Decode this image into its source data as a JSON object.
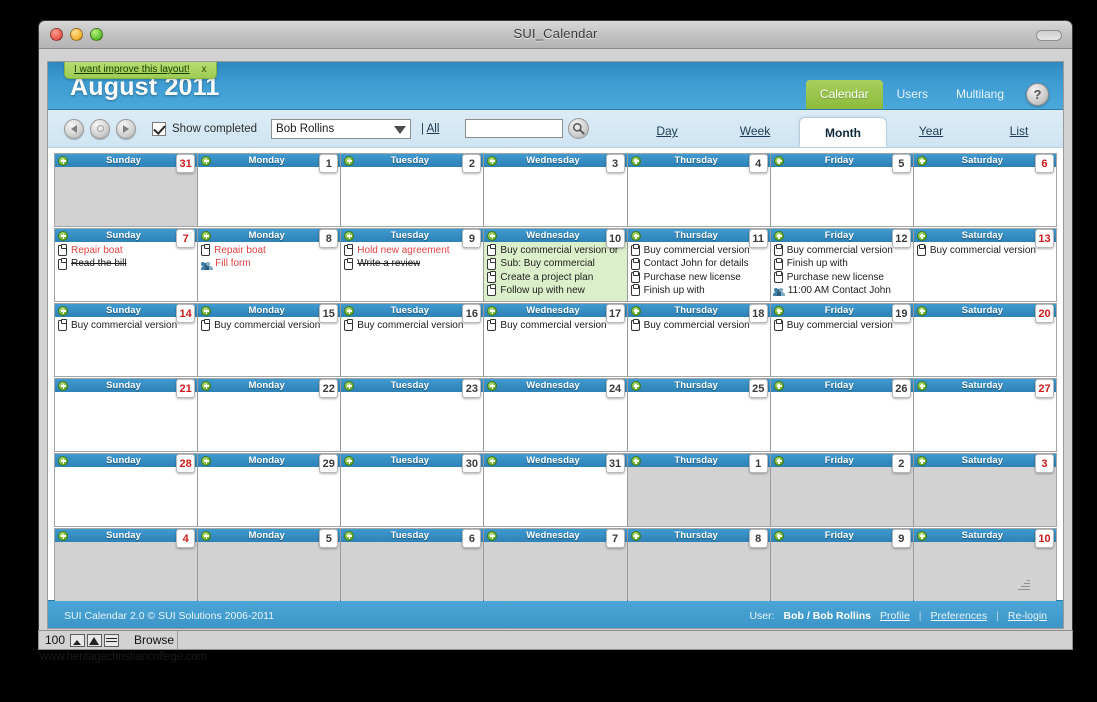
{
  "window": {
    "title": "SUI_Calendar",
    "traffic_lights": [
      "close",
      "minimize",
      "zoom"
    ]
  },
  "hint": {
    "text": "I want improve this layout!",
    "close": "x"
  },
  "header": {
    "month_title": "August 2011",
    "nav": [
      {
        "label": "Calendar",
        "active": true
      },
      {
        "label": "Users",
        "active": false
      },
      {
        "label": "Multilang",
        "active": false
      }
    ],
    "help_label": "?"
  },
  "toolbar": {
    "prev_label": "◀",
    "today_label": "●",
    "next_label": "▶",
    "show_completed_label": "Show completed",
    "show_completed_checked": true,
    "user_select_value": "Bob Rollins",
    "user_select_options": [
      "Bob Rollins"
    ],
    "all_separator": "|",
    "all_label": "All",
    "search_value": "",
    "search_placeholder": "",
    "search_icon": "search-icon"
  },
  "view_tabs": [
    {
      "label": "Day",
      "active": false
    },
    {
      "label": "Week",
      "active": false
    },
    {
      "label": "Month",
      "active": true
    },
    {
      "label": "Year",
      "active": false
    },
    {
      "label": "List",
      "active": false
    }
  ],
  "calendar": {
    "weekday_names": [
      "Sunday",
      "Monday",
      "Tuesday",
      "Wednesday",
      "Thursday",
      "Friday",
      "Saturday"
    ],
    "weeks": [
      {
        "days": [
          {
            "name": "Sunday",
            "num": "31",
            "weekend": true,
            "outside": true,
            "today": false,
            "events": []
          },
          {
            "name": "Monday",
            "num": "1",
            "weekend": false,
            "outside": false,
            "today": false,
            "events": []
          },
          {
            "name": "Tuesday",
            "num": "2",
            "weekend": false,
            "outside": false,
            "today": false,
            "events": []
          },
          {
            "name": "Wednesday",
            "num": "3",
            "weekend": false,
            "outside": false,
            "today": false,
            "events": []
          },
          {
            "name": "Thursday",
            "num": "4",
            "weekend": false,
            "outside": false,
            "today": false,
            "events": []
          },
          {
            "name": "Friday",
            "num": "5",
            "weekend": false,
            "outside": false,
            "today": false,
            "events": []
          },
          {
            "name": "Saturday",
            "num": "6",
            "weekend": true,
            "outside": false,
            "today": false,
            "events": []
          }
        ]
      },
      {
        "days": [
          {
            "name": "Sunday",
            "num": "7",
            "weekend": true,
            "outside": false,
            "today": false,
            "events": [
              {
                "icon": "task-icon",
                "text": "Repair boat",
                "state": "overdue"
              },
              {
                "icon": "task-icon",
                "text": "Read the bill",
                "state": "done"
              }
            ]
          },
          {
            "name": "Monday",
            "num": "8",
            "weekend": false,
            "outside": false,
            "today": false,
            "events": [
              {
                "icon": "task-icon",
                "text": "Repair boat",
                "state": "overdue"
              },
              {
                "icon": "meeting-icon",
                "text": "Fill form",
                "state": "overdue"
              }
            ]
          },
          {
            "name": "Tuesday",
            "num": "9",
            "weekend": false,
            "outside": false,
            "today": false,
            "events": [
              {
                "icon": "task-icon",
                "text": "Hold new agreement",
                "state": "overdue"
              },
              {
                "icon": "task-icon",
                "text": "Write a review",
                "state": "done"
              }
            ]
          },
          {
            "name": "Wednesday",
            "num": "10",
            "weekend": false,
            "outside": false,
            "today": true,
            "events": [
              {
                "icon": "task-icon",
                "text": "Buy commercial version or",
                "state": "normal"
              },
              {
                "icon": "task-icon",
                "text": "Sub: Buy commercial",
                "state": "normal"
              },
              {
                "icon": "task-icon",
                "text": "Create a project plan",
                "state": "normal"
              },
              {
                "icon": "task-icon",
                "text": "Follow up with new",
                "state": "normal"
              }
            ]
          },
          {
            "name": "Thursday",
            "num": "11",
            "weekend": false,
            "outside": false,
            "today": false,
            "events": [
              {
                "icon": "task-icon",
                "text": "Buy commercial version",
                "state": "normal"
              },
              {
                "icon": "task-icon",
                "text": "Contact John for details",
                "state": "normal"
              },
              {
                "icon": "task-icon",
                "text": "Purchase new license",
                "state": "normal"
              },
              {
                "icon": "task-icon",
                "text": "Finish up with",
                "state": "normal"
              }
            ]
          },
          {
            "name": "Friday",
            "num": "12",
            "weekend": false,
            "outside": false,
            "today": false,
            "events": [
              {
                "icon": "task-icon",
                "text": "Buy commercial version",
                "state": "normal"
              },
              {
                "icon": "task-icon",
                "text": "Finish up with",
                "state": "normal"
              },
              {
                "icon": "task-icon",
                "text": "Purchase new license",
                "state": "normal"
              },
              {
                "icon": "meeting-icon",
                "text": "11:00 AM Contact John",
                "state": "normal"
              }
            ]
          },
          {
            "name": "Saturday",
            "num": "13",
            "weekend": true,
            "outside": false,
            "today": false,
            "events": [
              {
                "icon": "task-icon",
                "text": "Buy commercial version",
                "state": "normal"
              }
            ]
          }
        ]
      },
      {
        "days": [
          {
            "name": "Sunday",
            "num": "14",
            "weekend": true,
            "outside": false,
            "today": false,
            "events": [
              {
                "icon": "task-icon",
                "text": "Buy commercial version",
                "state": "normal"
              }
            ]
          },
          {
            "name": "Monday",
            "num": "15",
            "weekend": false,
            "outside": false,
            "today": false,
            "events": [
              {
                "icon": "task-icon",
                "text": "Buy commercial version",
                "state": "normal"
              }
            ]
          },
          {
            "name": "Tuesday",
            "num": "16",
            "weekend": false,
            "outside": false,
            "today": false,
            "events": [
              {
                "icon": "task-icon",
                "text": "Buy commercial version",
                "state": "normal"
              }
            ]
          },
          {
            "name": "Wednesday",
            "num": "17",
            "weekend": false,
            "outside": false,
            "today": false,
            "events": [
              {
                "icon": "task-icon",
                "text": "Buy commercial version",
                "state": "normal"
              }
            ]
          },
          {
            "name": "Thursday",
            "num": "18",
            "weekend": false,
            "outside": false,
            "today": false,
            "events": [
              {
                "icon": "task-icon",
                "text": "Buy commercial version",
                "state": "normal"
              }
            ]
          },
          {
            "name": "Friday",
            "num": "19",
            "weekend": false,
            "outside": false,
            "today": false,
            "events": [
              {
                "icon": "task-icon",
                "text": "Buy commercial version",
                "state": "normal"
              }
            ]
          },
          {
            "name": "Saturday",
            "num": "20",
            "weekend": true,
            "outside": false,
            "today": false,
            "events": []
          }
        ]
      },
      {
        "days": [
          {
            "name": "Sunday",
            "num": "21",
            "weekend": true,
            "outside": false,
            "today": false,
            "events": []
          },
          {
            "name": "Monday",
            "num": "22",
            "weekend": false,
            "outside": false,
            "today": false,
            "events": []
          },
          {
            "name": "Tuesday",
            "num": "23",
            "weekend": false,
            "outside": false,
            "today": false,
            "events": []
          },
          {
            "name": "Wednesday",
            "num": "24",
            "weekend": false,
            "outside": false,
            "today": false,
            "events": []
          },
          {
            "name": "Thursday",
            "num": "25",
            "weekend": false,
            "outside": false,
            "today": false,
            "events": []
          },
          {
            "name": "Friday",
            "num": "26",
            "weekend": false,
            "outside": false,
            "today": false,
            "events": []
          },
          {
            "name": "Saturday",
            "num": "27",
            "weekend": true,
            "outside": false,
            "today": false,
            "events": []
          }
        ]
      },
      {
        "days": [
          {
            "name": "Sunday",
            "num": "28",
            "weekend": true,
            "outside": false,
            "today": false,
            "events": []
          },
          {
            "name": "Monday",
            "num": "29",
            "weekend": false,
            "outside": false,
            "today": false,
            "events": []
          },
          {
            "name": "Tuesday",
            "num": "30",
            "weekend": false,
            "outside": false,
            "today": false,
            "events": []
          },
          {
            "name": "Wednesday",
            "num": "31",
            "weekend": false,
            "outside": false,
            "today": false,
            "events": []
          },
          {
            "name": "Thursday",
            "num": "1",
            "weekend": false,
            "outside": true,
            "today": false,
            "events": []
          },
          {
            "name": "Friday",
            "num": "2",
            "weekend": false,
            "outside": true,
            "today": false,
            "events": []
          },
          {
            "name": "Saturday",
            "num": "3",
            "weekend": true,
            "outside": true,
            "today": false,
            "events": []
          }
        ]
      },
      {
        "days": [
          {
            "name": "Sunday",
            "num": "4",
            "weekend": true,
            "outside": true,
            "today": false,
            "events": []
          },
          {
            "name": "Monday",
            "num": "5",
            "weekend": false,
            "outside": true,
            "today": false,
            "events": []
          },
          {
            "name": "Tuesday",
            "num": "6",
            "weekend": false,
            "outside": true,
            "today": false,
            "events": []
          },
          {
            "name": "Wednesday",
            "num": "7",
            "weekend": false,
            "outside": true,
            "today": false,
            "events": []
          },
          {
            "name": "Thursday",
            "num": "8",
            "weekend": false,
            "outside": true,
            "today": false,
            "events": []
          },
          {
            "name": "Friday",
            "num": "9",
            "weekend": false,
            "outside": true,
            "today": false,
            "events": []
          },
          {
            "name": "Saturday",
            "num": "10",
            "weekend": true,
            "outside": true,
            "today": false,
            "events": []
          }
        ]
      }
    ]
  },
  "footer": {
    "copyright": "SUI Calendar 2.0 © SUI Solutions 2006-2011",
    "user_label": "User:",
    "user_value": "Bob / Bob Rollins",
    "profile_label": "Profile",
    "sep1": "|",
    "preferences_label": "Preferences",
    "sep2": "|",
    "relogin_label": "Re-login"
  },
  "status_bar": {
    "zoom_level": "100",
    "mode_label": "Browse"
  },
  "url_text": "www.heritagechristiancollege.com",
  "colors": {
    "brand_blue": "#3d9bd1",
    "accent_green": "#8cbb3c",
    "today_bg": "#dcefcb",
    "overdue_red": "#e24343",
    "weekend_red": "#cc1b1b"
  }
}
